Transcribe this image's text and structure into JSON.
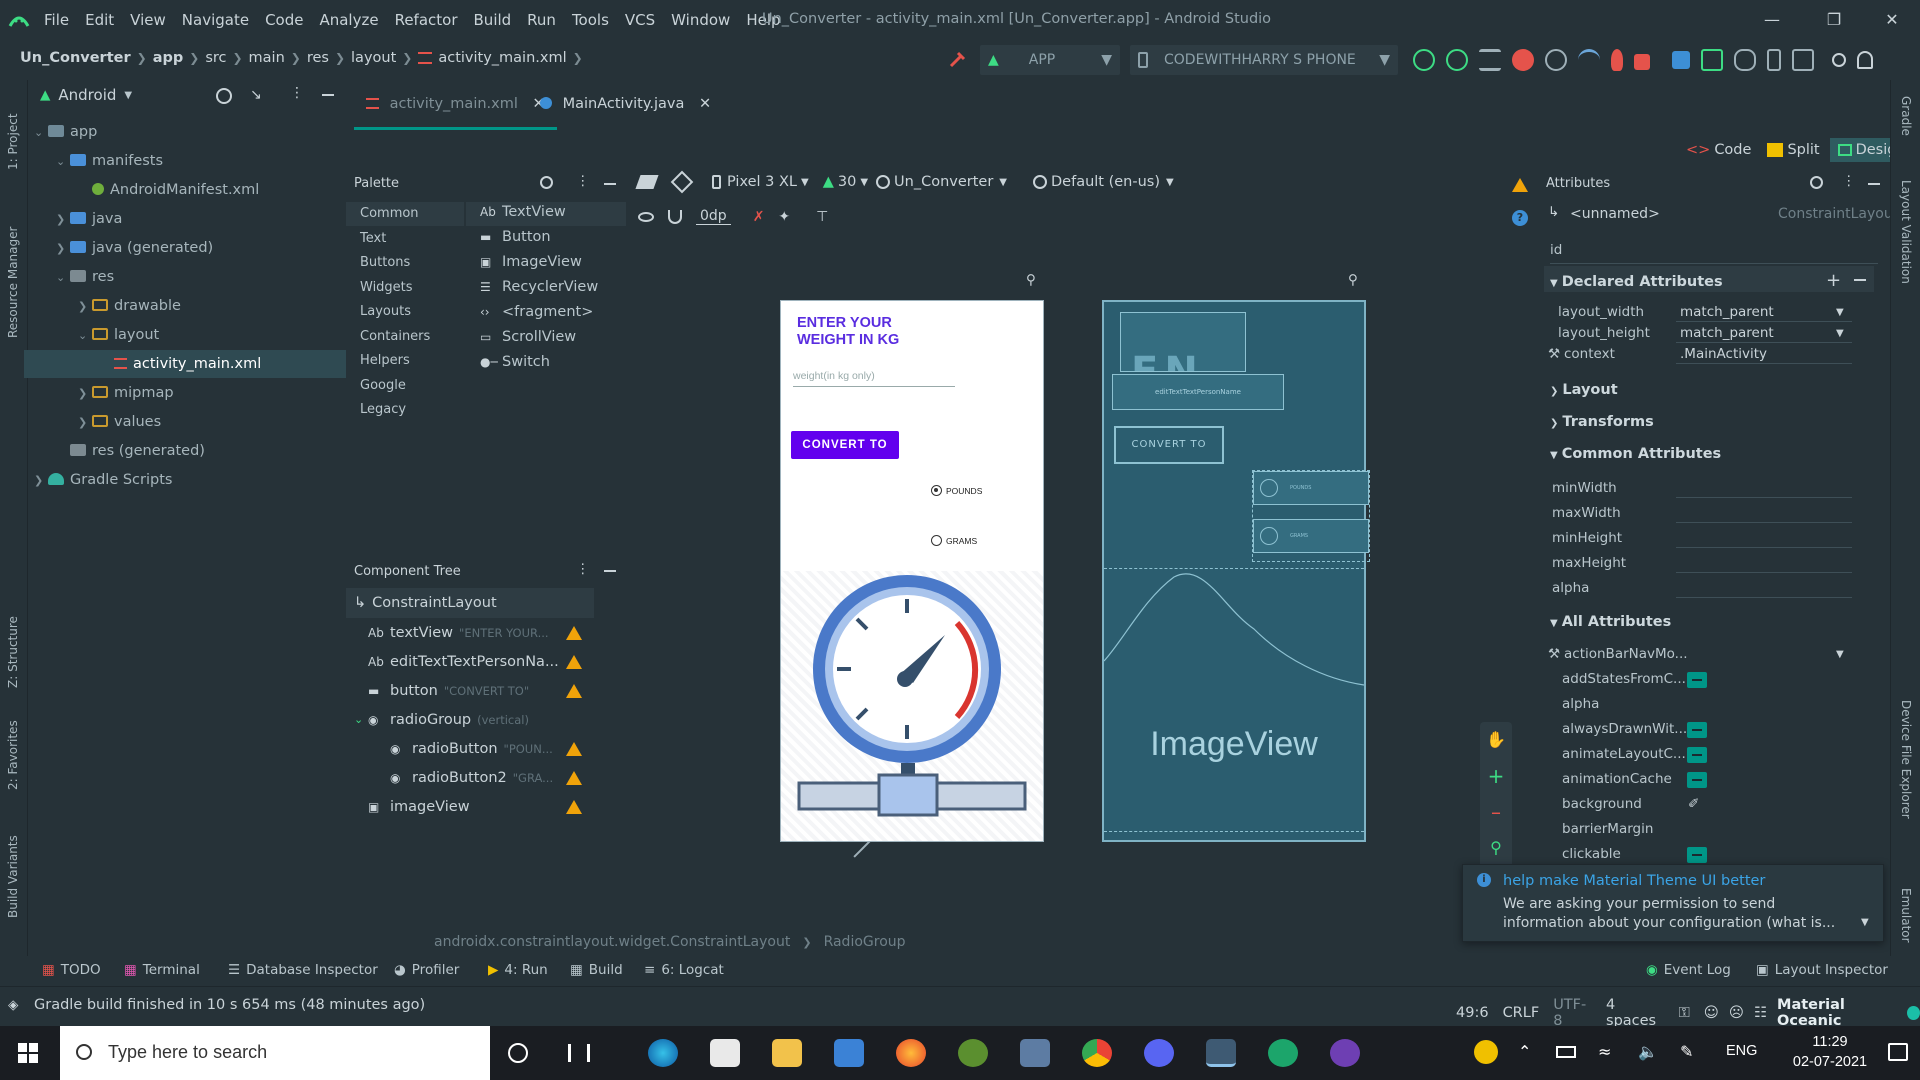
{
  "window": {
    "title": "Un_Converter - activity_main.xml [Un_Converter.app] - Android Studio",
    "menu": [
      "File",
      "Edit",
      "View",
      "Navigate",
      "Code",
      "Analyze",
      "Refactor",
      "Build",
      "Run",
      "Tools",
      "VCS",
      "Window",
      "Help"
    ]
  },
  "breadcrumb": [
    "Un_Converter",
    "app",
    "src",
    "main",
    "res",
    "layout",
    "activity_main.xml"
  ],
  "toolbar": {
    "config": "APP",
    "device": "CODEWITHHARRY S PHONE"
  },
  "left_strip": [
    "1: Project",
    "Resource Manager",
    "Z: Structure",
    "2: Favorites",
    "Build Variants"
  ],
  "right_strip": [
    "Gradle",
    "Layout Validation",
    "Device File Explorer",
    "Emulator"
  ],
  "project": {
    "view": "Android",
    "tree": [
      {
        "label": "app",
        "indent": 0,
        "expanded": true,
        "kind": "module"
      },
      {
        "label": "manifests",
        "indent": 1,
        "expanded": true,
        "kind": "folder"
      },
      {
        "label": "AndroidManifest.xml",
        "indent": 2,
        "expanded": null,
        "kind": "manifest"
      },
      {
        "label": "java",
        "indent": 1,
        "expanded": false,
        "kind": "folder"
      },
      {
        "label": "java (generated)",
        "indent": 1,
        "expanded": false,
        "kind": "folder-gen"
      },
      {
        "label": "res",
        "indent": 1,
        "expanded": true,
        "kind": "res"
      },
      {
        "label": "drawable",
        "indent": 2,
        "expanded": false,
        "kind": "dir"
      },
      {
        "label": "layout",
        "indent": 2,
        "expanded": true,
        "kind": "dir"
      },
      {
        "label": "activity_main.xml",
        "indent": 3,
        "expanded": null,
        "kind": "layout-file"
      },
      {
        "label": "mipmap",
        "indent": 2,
        "expanded": false,
        "kind": "dir"
      },
      {
        "label": "values",
        "indent": 2,
        "expanded": false,
        "kind": "dir"
      },
      {
        "label": "res (generated)",
        "indent": 1,
        "expanded": null,
        "kind": "res"
      },
      {
        "label": "Gradle Scripts",
        "indent": 0,
        "expanded": false,
        "kind": "gradle"
      }
    ]
  },
  "editor_tabs": [
    {
      "label": "activity_main.xml",
      "active": true
    },
    {
      "label": "MainActivity.java",
      "active": false
    }
  ],
  "view_modes": [
    "Code",
    "Split",
    "Design"
  ],
  "palette": {
    "title": "Palette",
    "categories": [
      "Common",
      "Text",
      "Buttons",
      "Widgets",
      "Layouts",
      "Containers",
      "Helpers",
      "Google",
      "Legacy"
    ],
    "items": [
      "TextView",
      "Button",
      "ImageView",
      "RecyclerView",
      "<fragment>",
      "ScrollView",
      "Switch"
    ]
  },
  "design_toolbar": {
    "device": "Pixel 3 XL",
    "api": "30",
    "theme": "Un_Converter",
    "locale": "Default (en-us)",
    "margin": "0dp"
  },
  "component_tree": {
    "title": "Component Tree",
    "root": "ConstraintLayout",
    "items": [
      {
        "name": "textView",
        "hint": "\"ENTER YOUR...",
        "indent": 1
      },
      {
        "name": "editTextTextPersonNa...",
        "hint": "",
        "indent": 1
      },
      {
        "name": "button",
        "hint": "\"CONVERT TO\"",
        "indent": 1
      },
      {
        "name": "radioGroup",
        "hint": "(vertical)",
        "indent": 1
      },
      {
        "name": "radioButton",
        "hint": "\"POUN...",
        "indent": 2
      },
      {
        "name": "radioButton2",
        "hint": "\"GRA...",
        "indent": 2
      },
      {
        "name": "imageView",
        "hint": "",
        "indent": 1
      }
    ]
  },
  "phone_preview": {
    "heading": "ENTER YOUR\nWEIGHT IN KG",
    "input_hint": "weight(in kg only)",
    "button": "CONVERT TO",
    "radio1": "POUNDS",
    "radio2": "GRAMS"
  },
  "blueprint": {
    "edittext": "editTextTextPersonName",
    "button": "CONVERT TO",
    "radio1": "POUNDS",
    "radio2": "GRAMS",
    "imageview": "ImageView"
  },
  "attributes": {
    "title": "Attributes",
    "element": "<unnamed>",
    "element_type": "ConstraintLayout",
    "id_label": "id",
    "declared_title": "Declared Attributes",
    "declared": [
      {
        "name": "layout_width",
        "value": "match_parent"
      },
      {
        "name": "layout_height",
        "value": "match_parent"
      },
      {
        "name": "context",
        "value": ".MainActivity"
      }
    ],
    "layout_section": "Layout",
    "transforms_section": "Transforms",
    "common_title": "Common Attributes",
    "common": [
      "minWidth",
      "maxWidth",
      "minHeight",
      "maxHeight",
      "alpha"
    ],
    "all_title": "All Attributes",
    "all": [
      "actionBarNavMo...",
      "addStatesFromC...",
      "alpha",
      "alwaysDrawnWit...",
      "animateLayoutC...",
      "animationCache",
      "background",
      "barrierMargin",
      "clickable"
    ]
  },
  "notification": {
    "title": "help make Material Theme UI better",
    "body": "We are asking your permission to send information about your configuration (what is..."
  },
  "path_bar": [
    "androidx.constraintlayout.widget.ConstraintLayout",
    "RadioGroup"
  ],
  "tool_windows": [
    "TODO",
    "Terminal",
    "Database Inspector",
    "Profiler",
    "4: Run",
    "Build",
    "6: Logcat"
  ],
  "tool_windows_right": [
    "Event Log",
    "Layout Inspector"
  ],
  "status": {
    "message": "Gradle build finished in 10 s 654 ms (48 minutes ago)",
    "position": "49:6",
    "line_sep": "CRLF",
    "encoding": "UTF-8",
    "indent": "4 spaces",
    "theme": "Material Oceanic"
  },
  "taskbar": {
    "search_placeholder": "Type here to search",
    "lang": "ENG",
    "time": "11:29",
    "date": "02-07-2021"
  },
  "colors": {
    "accent": "#009688",
    "warning": "#f0a30a",
    "button_purple": "#6200ee",
    "bg": "#263238"
  }
}
